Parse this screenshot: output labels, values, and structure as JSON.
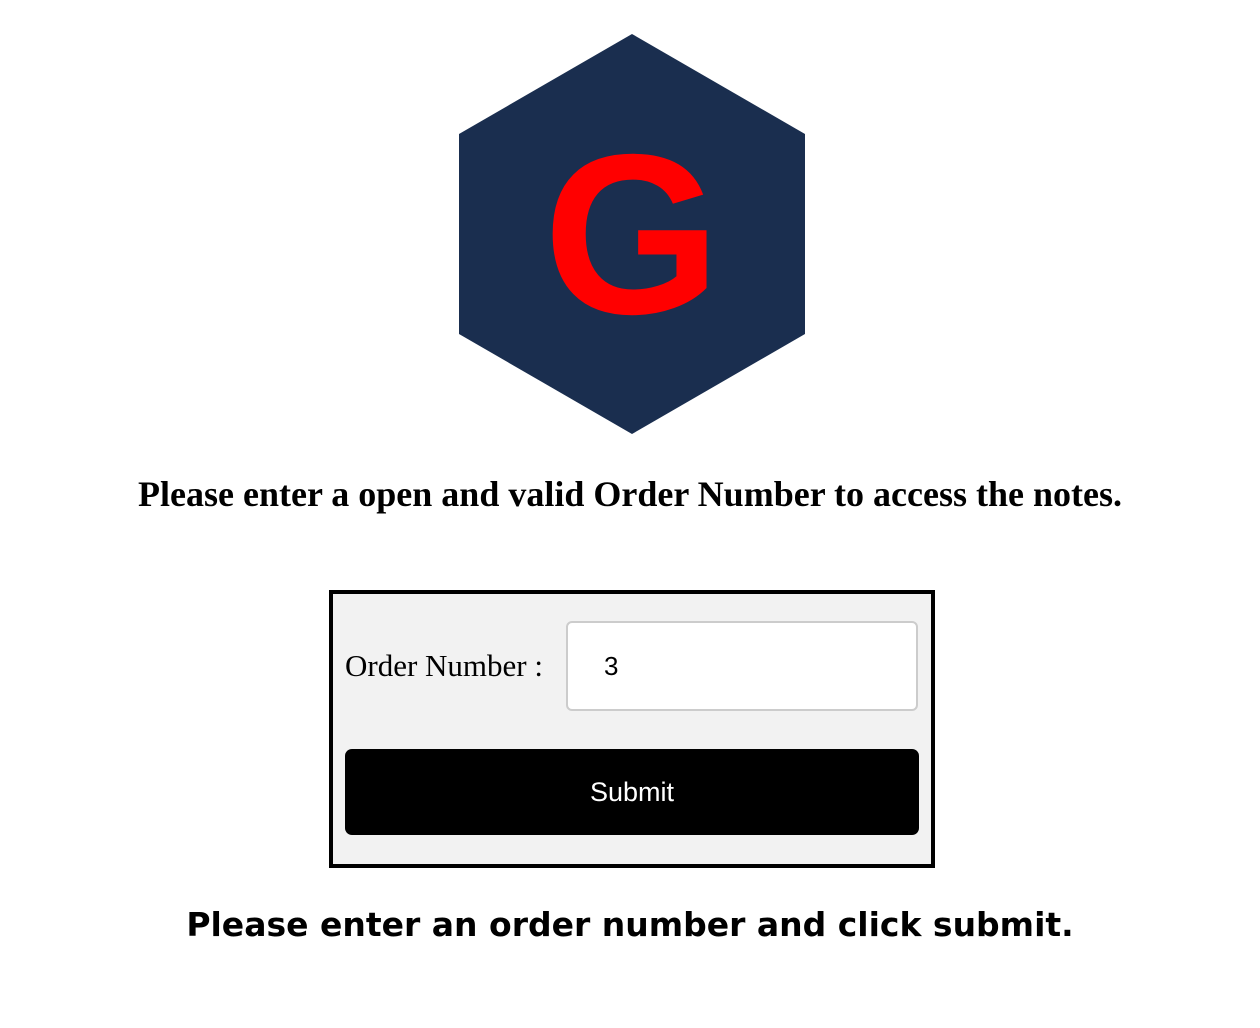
{
  "colors": {
    "logo_background": "#1a2e4f",
    "logo_letter": "#ff0000",
    "form_background": "#f2f2f2",
    "button_background": "#000000",
    "button_text": "#ffffff"
  },
  "logo": {
    "letter": "G",
    "icon": "hexagon-logo-icon"
  },
  "heading": "Please enter a open and valid Order Number to access the notes.",
  "form": {
    "order_label": "Order Number :",
    "order_value": "3",
    "submit_label": "Submit"
  },
  "status_message": "Please enter an order number and click submit."
}
